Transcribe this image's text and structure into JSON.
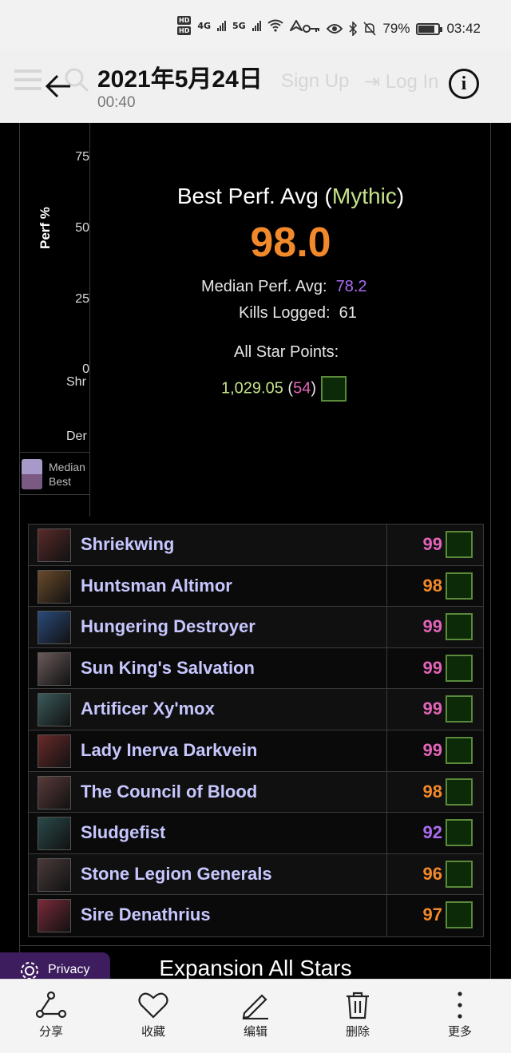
{
  "status_bar": {
    "hd1": "HD",
    "hd2": "HD",
    "net1": "4G",
    "net2": "5G",
    "battery": "79%",
    "time": "03:42"
  },
  "header": {
    "title": "2021年5月24日",
    "subtitle": "00:40",
    "ghost_signup": "Sign Up",
    "ghost_login": "Log In",
    "info_label": "i"
  },
  "chart": {
    "yticks": [
      "75",
      "50",
      "25",
      "0"
    ],
    "ylabel": "Perf %",
    "xticks": [
      "Shr",
      "Der"
    ],
    "legend": [
      "Median",
      "Best"
    ],
    "colors": {
      "median": "#a89ac8",
      "best": "#7a5a82"
    }
  },
  "summary": {
    "heading_prefix": "Best Perf. Avg (",
    "heading_mode": "Mythic",
    "heading_suffix": ")",
    "best_perf_avg": "98.0",
    "median_label": "Median Perf. Avg:",
    "median_value": "78.2",
    "kills_label": "Kills Logged:",
    "kills_value": "61",
    "allstar_label": "All Star Points:",
    "allstar_points": "1,029.05",
    "allstar_rank": "54"
  },
  "bosses": [
    {
      "name": "Shriekwing",
      "score": "99",
      "color": "#e264b8"
    },
    {
      "name": "Huntsman Altimor",
      "score": "98",
      "color": "#f2892a"
    },
    {
      "name": "Hungering Destroyer",
      "score": "99",
      "color": "#e264b8"
    },
    {
      "name": "Sun King's Salvation",
      "score": "99",
      "color": "#e264b8"
    },
    {
      "name": "Artificer Xy'mox",
      "score": "99",
      "color": "#e264b8"
    },
    {
      "name": "Lady Inerva Darkvein",
      "score": "99",
      "color": "#e264b8"
    },
    {
      "name": "The Council of Blood",
      "score": "98",
      "color": "#f2892a"
    },
    {
      "name": "Sludgefist",
      "score": "92",
      "color": "#a96cf0"
    },
    {
      "name": "Stone Legion Generals",
      "score": "96",
      "color": "#f2892a"
    },
    {
      "name": "Sire Denathrius",
      "score": "97",
      "color": "#f2892a"
    }
  ],
  "section_heading": "Expansion All Stars",
  "privacy_label": "Privacy",
  "bottom_bar": [
    {
      "label": "分享",
      "icon": "share-icon"
    },
    {
      "label": "收藏",
      "icon": "heart-icon"
    },
    {
      "label": "编辑",
      "icon": "pencil-icon"
    },
    {
      "label": "删除",
      "icon": "trash-icon"
    },
    {
      "label": "更多",
      "icon": "more-icon"
    }
  ]
}
